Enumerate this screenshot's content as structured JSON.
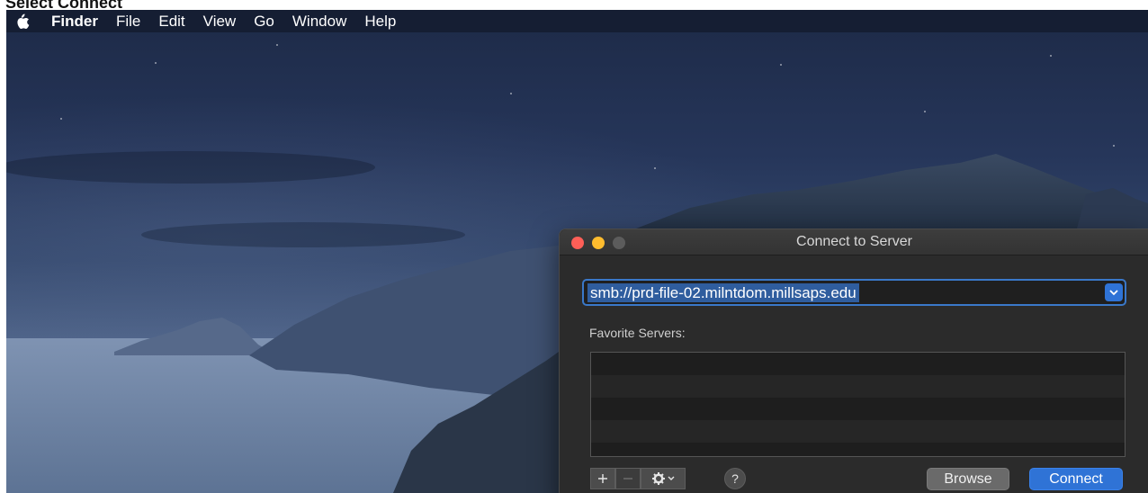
{
  "instruction": "Select Connect",
  "menubar": {
    "apple_icon": "apple-logo-icon",
    "items": [
      {
        "label": "Finder",
        "bold": true
      },
      {
        "label": "File"
      },
      {
        "label": "Edit"
      },
      {
        "label": "View"
      },
      {
        "label": "Go"
      },
      {
        "label": "Window"
      },
      {
        "label": "Help"
      }
    ]
  },
  "dialog": {
    "title": "Connect to Server",
    "traffic_lights": {
      "close": "#ff5f57",
      "minimize": "#febc2e",
      "zoom": "#5c5c5c"
    },
    "server_address": {
      "value": "smb://prd-file-02.milntdom.millsaps.edu",
      "dropdown_icon": "chevron-down-icon"
    },
    "favorites_label": "Favorite Servers:",
    "favorites": [],
    "toolbar": {
      "add_icon": "plus-icon",
      "remove_icon": "minus-icon",
      "gear_icon": "gear-icon",
      "help_label": "?"
    },
    "buttons": {
      "browse": "Browse",
      "connect": "Connect"
    }
  },
  "colors": {
    "accent": "#2f73d6",
    "dialog_bg": "#2b2b2b",
    "selection": "#2f5d9e"
  }
}
